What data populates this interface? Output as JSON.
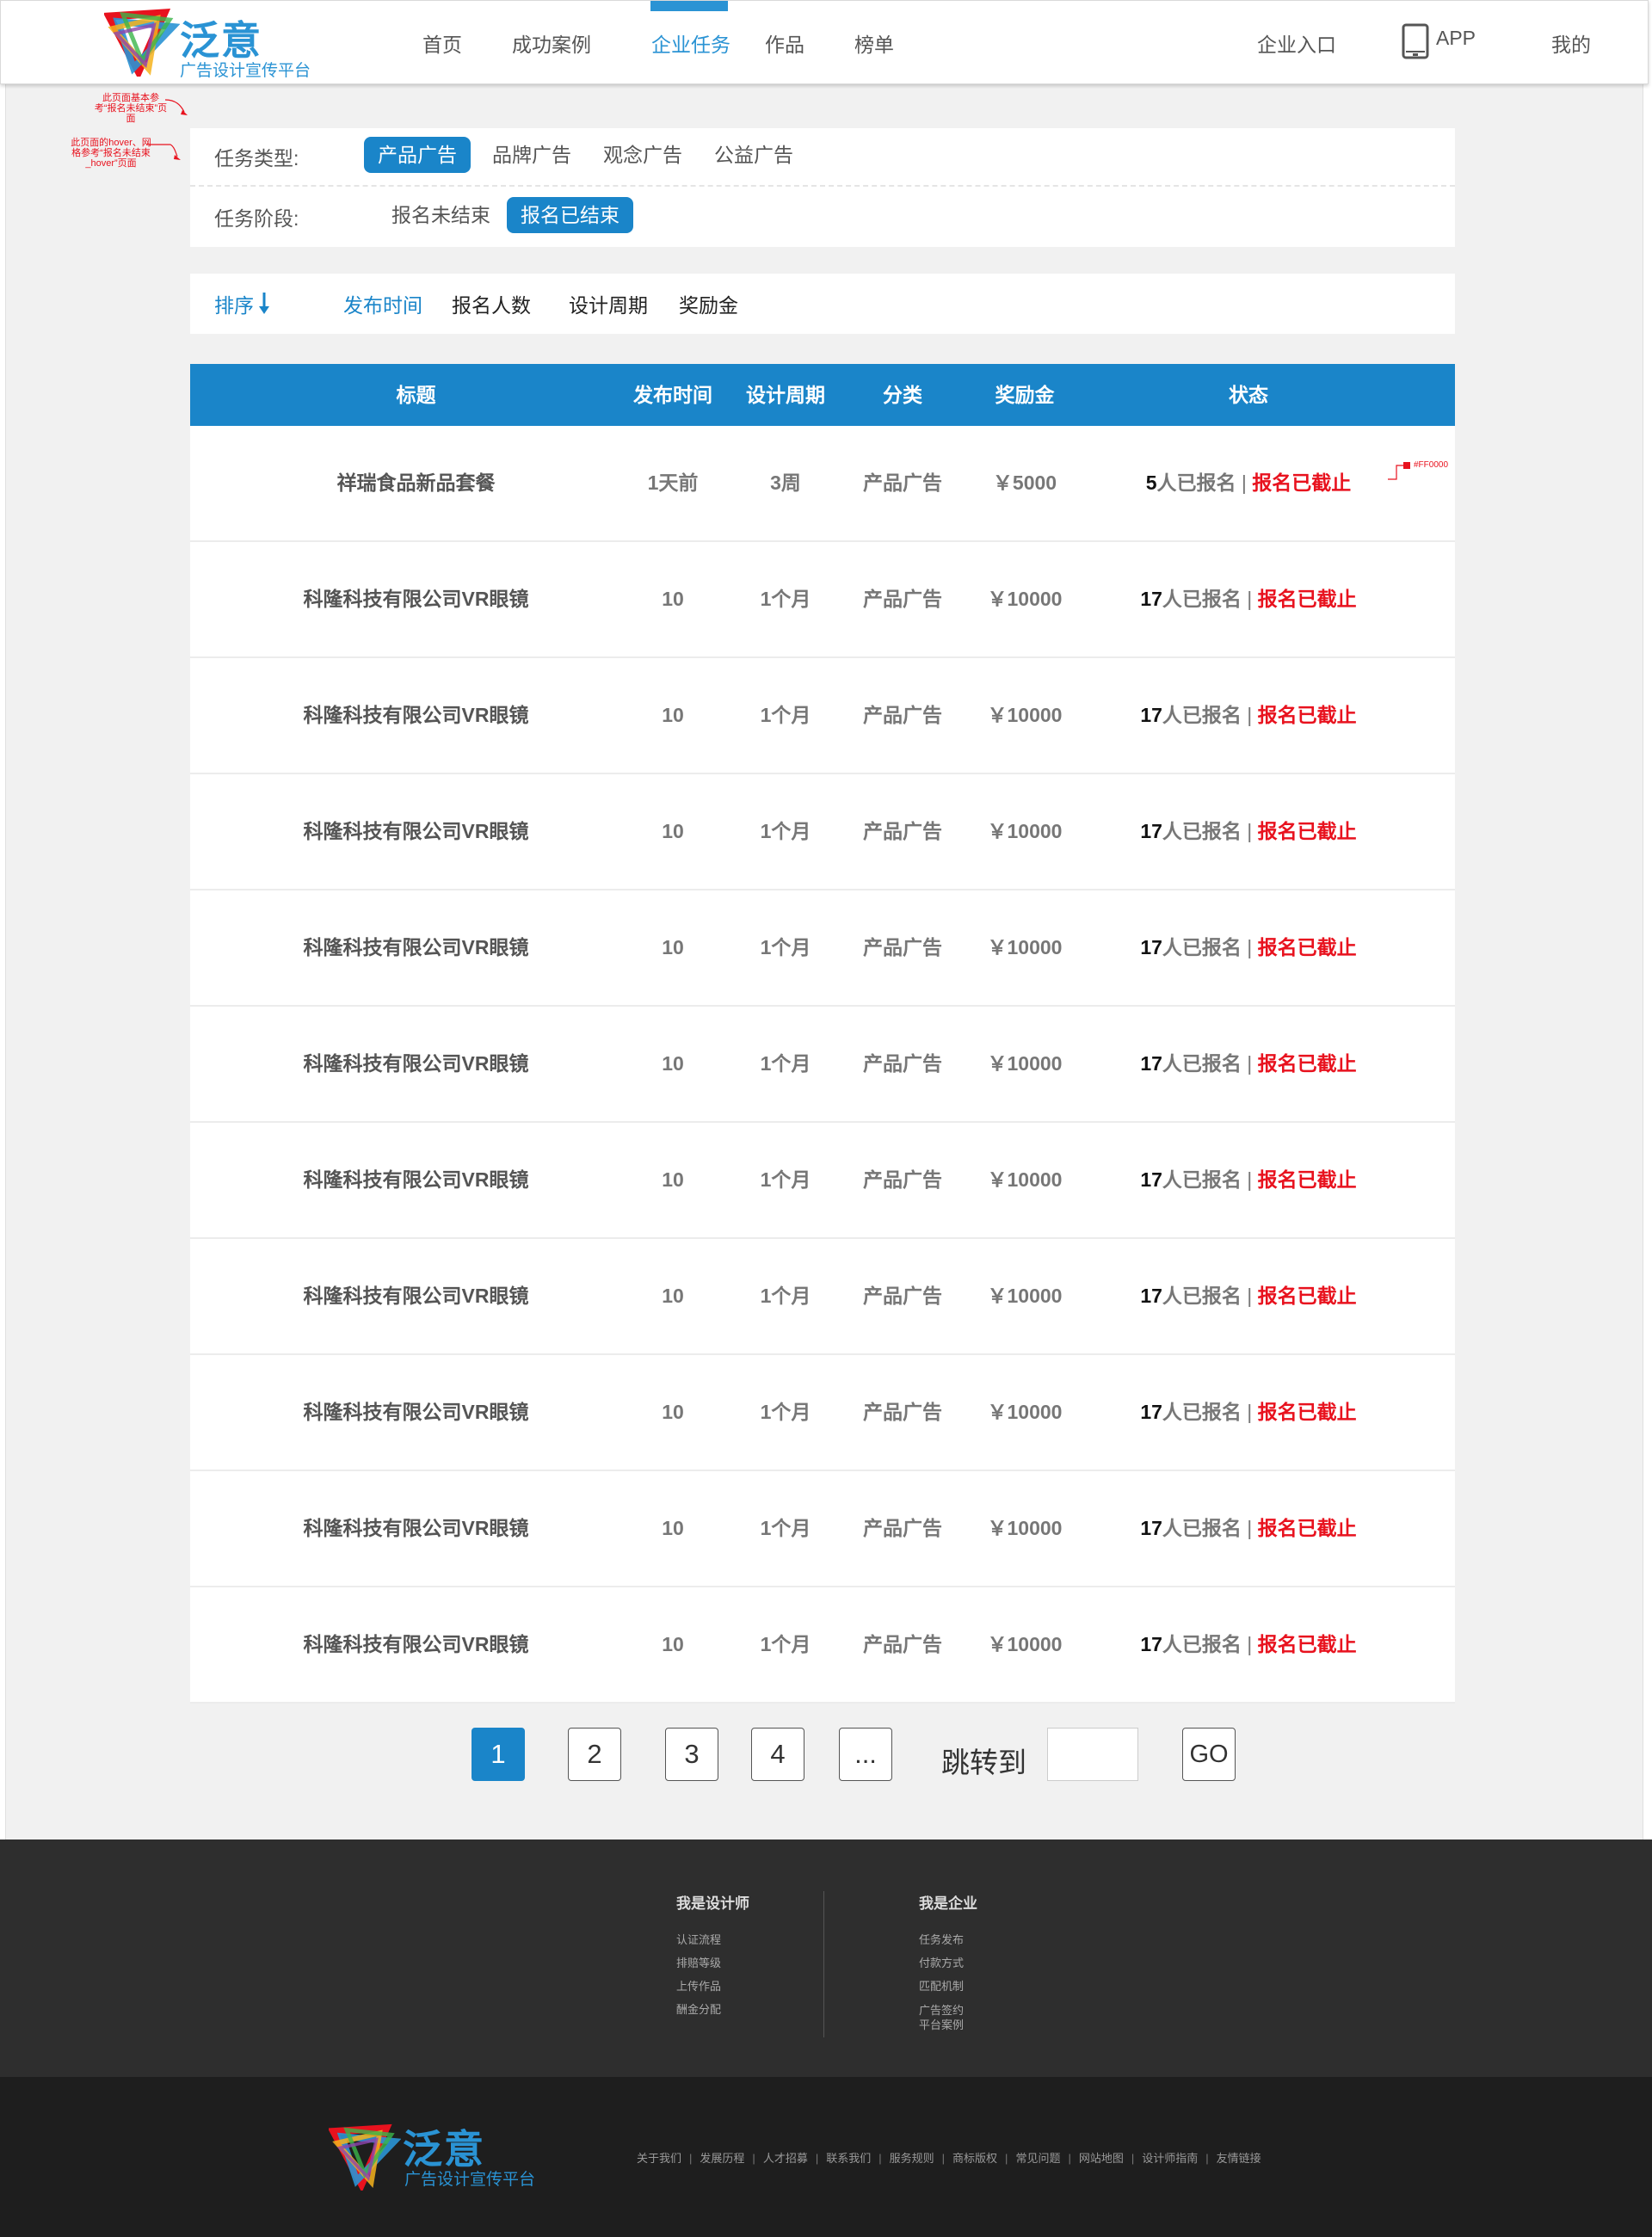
{
  "header": {
    "brand": "泛意",
    "slogan": "广告设计宣传平台",
    "nav": [
      "首页",
      "成功案例",
      "企业任务",
      "作品",
      "榜单"
    ],
    "active_nav": "企业任务",
    "enterprise_entry": "企业入口",
    "app_label": "APP",
    "mine": "我的"
  },
  "annotations": {
    "note1": "此页面基本参考“报名未结束”页面",
    "note2": "此页面的hover、网格参考“报名未结束_hover”页面",
    "color_note": "#FF0000"
  },
  "filters": {
    "type_label": "任务类型:",
    "types": [
      "产品广告",
      "品牌广告",
      "观念广告",
      "公益广告"
    ],
    "type_selected": "产品广告",
    "stage_label": "任务阶段:",
    "stages": [
      "报名未结束",
      "报名已结束"
    ],
    "stage_selected": "报名已结束"
  },
  "sort": {
    "label": "排序",
    "options": [
      "发布时间",
      "报名人数",
      "设计周期",
      "奖励金"
    ],
    "selected": "发布时间"
  },
  "table": {
    "columns": [
      "标题",
      "发布时间",
      "设计周期",
      "分类",
      "奖励金",
      "状态"
    ],
    "rows": [
      {
        "title": "祥瑞食品新品套餐",
        "time": "1天前",
        "period": "3周",
        "category": "产品广告",
        "bonus": "￥5000",
        "count": "5",
        "signed_text": "人已报名",
        "sep": "|",
        "closed": "报名已截止"
      },
      {
        "title": "科隆科技有限公司VR眼镜",
        "time": "10",
        "period": "1个月",
        "category": "产品广告",
        "bonus": "￥10000",
        "count": "17",
        "signed_text": "人已报名",
        "sep": "|",
        "closed": "报名已截止"
      },
      {
        "title": "科隆科技有限公司VR眼镜",
        "time": "10",
        "period": "1个月",
        "category": "产品广告",
        "bonus": "￥10000",
        "count": "17",
        "signed_text": "人已报名",
        "sep": "|",
        "closed": "报名已截止"
      },
      {
        "title": "科隆科技有限公司VR眼镜",
        "time": "10",
        "period": "1个月",
        "category": "产品广告",
        "bonus": "￥10000",
        "count": "17",
        "signed_text": "人已报名",
        "sep": "|",
        "closed": "报名已截止"
      },
      {
        "title": "科隆科技有限公司VR眼镜",
        "time": "10",
        "period": "1个月",
        "category": "产品广告",
        "bonus": "￥10000",
        "count": "17",
        "signed_text": "人已报名",
        "sep": "|",
        "closed": "报名已截止"
      },
      {
        "title": "科隆科技有限公司VR眼镜",
        "time": "10",
        "period": "1个月",
        "category": "产品广告",
        "bonus": "￥10000",
        "count": "17",
        "signed_text": "人已报名",
        "sep": "|",
        "closed": "报名已截止"
      },
      {
        "title": "科隆科技有限公司VR眼镜",
        "time": "10",
        "period": "1个月",
        "category": "产品广告",
        "bonus": "￥10000",
        "count": "17",
        "signed_text": "人已报名",
        "sep": "|",
        "closed": "报名已截止"
      },
      {
        "title": "科隆科技有限公司VR眼镜",
        "time": "10",
        "period": "1个月",
        "category": "产品广告",
        "bonus": "￥10000",
        "count": "17",
        "signed_text": "人已报名",
        "sep": "|",
        "closed": "报名已截止"
      },
      {
        "title": "科隆科技有限公司VR眼镜",
        "time": "10",
        "period": "1个月",
        "category": "产品广告",
        "bonus": "￥10000",
        "count": "17",
        "signed_text": "人已报名",
        "sep": "|",
        "closed": "报名已截止"
      },
      {
        "title": "科隆科技有限公司VR眼镜",
        "time": "10",
        "period": "1个月",
        "category": "产品广告",
        "bonus": "￥10000",
        "count": "17",
        "signed_text": "人已报名",
        "sep": "|",
        "closed": "报名已截止"
      },
      {
        "title": "科隆科技有限公司VR眼镜",
        "time": "10",
        "period": "1个月",
        "category": "产品广告",
        "bonus": "￥10000",
        "count": "17",
        "signed_text": "人已报名",
        "sep": "|",
        "closed": "报名已截止"
      }
    ]
  },
  "chart_data": {
    "type": "table",
    "columns": [
      "标题",
      "发布时间",
      "设计周期",
      "分类",
      "奖励金",
      "状态"
    ],
    "rows": [
      [
        "祥瑞食品新品套餐",
        "1天前",
        "3周",
        "产品广告",
        "￥5000",
        "5人已报名 | 报名已截止"
      ],
      [
        "科隆科技有限公司VR眼镜",
        "10",
        "1个月",
        "产品广告",
        "￥10000",
        "17人已报名 | 报名已截止"
      ],
      [
        "科隆科技有限公司VR眼镜",
        "10",
        "1个月",
        "产品广告",
        "￥10000",
        "17人已报名 | 报名已截止"
      ],
      [
        "科隆科技有限公司VR眼镜",
        "10",
        "1个月",
        "产品广告",
        "￥10000",
        "17人已报名 | 报名已截止"
      ],
      [
        "科隆科技有限公司VR眼镜",
        "10",
        "1个月",
        "产品广告",
        "￥10000",
        "17人已报名 | 报名已截止"
      ],
      [
        "科隆科技有限公司VR眼镜",
        "10",
        "1个月",
        "产品广告",
        "￥10000",
        "17人已报名 | 报名已截止"
      ],
      [
        "科隆科技有限公司VR眼镜",
        "10",
        "1个月",
        "产品广告",
        "￥10000",
        "17人已报名 | 报名已截止"
      ],
      [
        "科隆科技有限公司VR眼镜",
        "10",
        "1个月",
        "产品广告",
        "￥10000",
        "17人已报名 | 报名已截止"
      ],
      [
        "科隆科技有限公司VR眼镜",
        "10",
        "1个月",
        "产品广告",
        "￥10000",
        "17人已报名 | 报名已截止"
      ],
      [
        "科隆科技有限公司VR眼镜",
        "10",
        "1个月",
        "产品广告",
        "￥10000",
        "17人已报名 | 报名已截止"
      ],
      [
        "科隆科技有限公司VR眼镜",
        "10",
        "1个月",
        "产品广告",
        "￥10000",
        "17人已报名 | 报名已截止"
      ]
    ]
  },
  "pagination": {
    "pages": [
      "1",
      "2",
      "3",
      "4",
      "..."
    ],
    "current": "1",
    "jump_label": "跳转到",
    "jump_value": "",
    "go_label": "GO"
  },
  "footer": {
    "designer_title": "我是设计师",
    "designer_links": [
      "认证流程",
      "排赔等级",
      "上传作品",
      "酬金分配"
    ],
    "company_title": "我是企业",
    "company_links": [
      "任务发布",
      "付款方式",
      "匹配机制",
      "广告签约",
      "平台案例"
    ],
    "brand": "泛意",
    "slogan": "广告设计宣传平台",
    "bottom_links": [
      "关于我们",
      "发展历程",
      "人才招募",
      "联系我们",
      "服务规则",
      "商标版权",
      "常见问题",
      "网站地图",
      "设计师指南",
      "友情链接"
    ]
  },
  "colors": {
    "primary": "#1a85c9",
    "closed": "#e8121e",
    "footer_top": "#2e2e2e",
    "footer_bottom": "#1e1e1e"
  }
}
